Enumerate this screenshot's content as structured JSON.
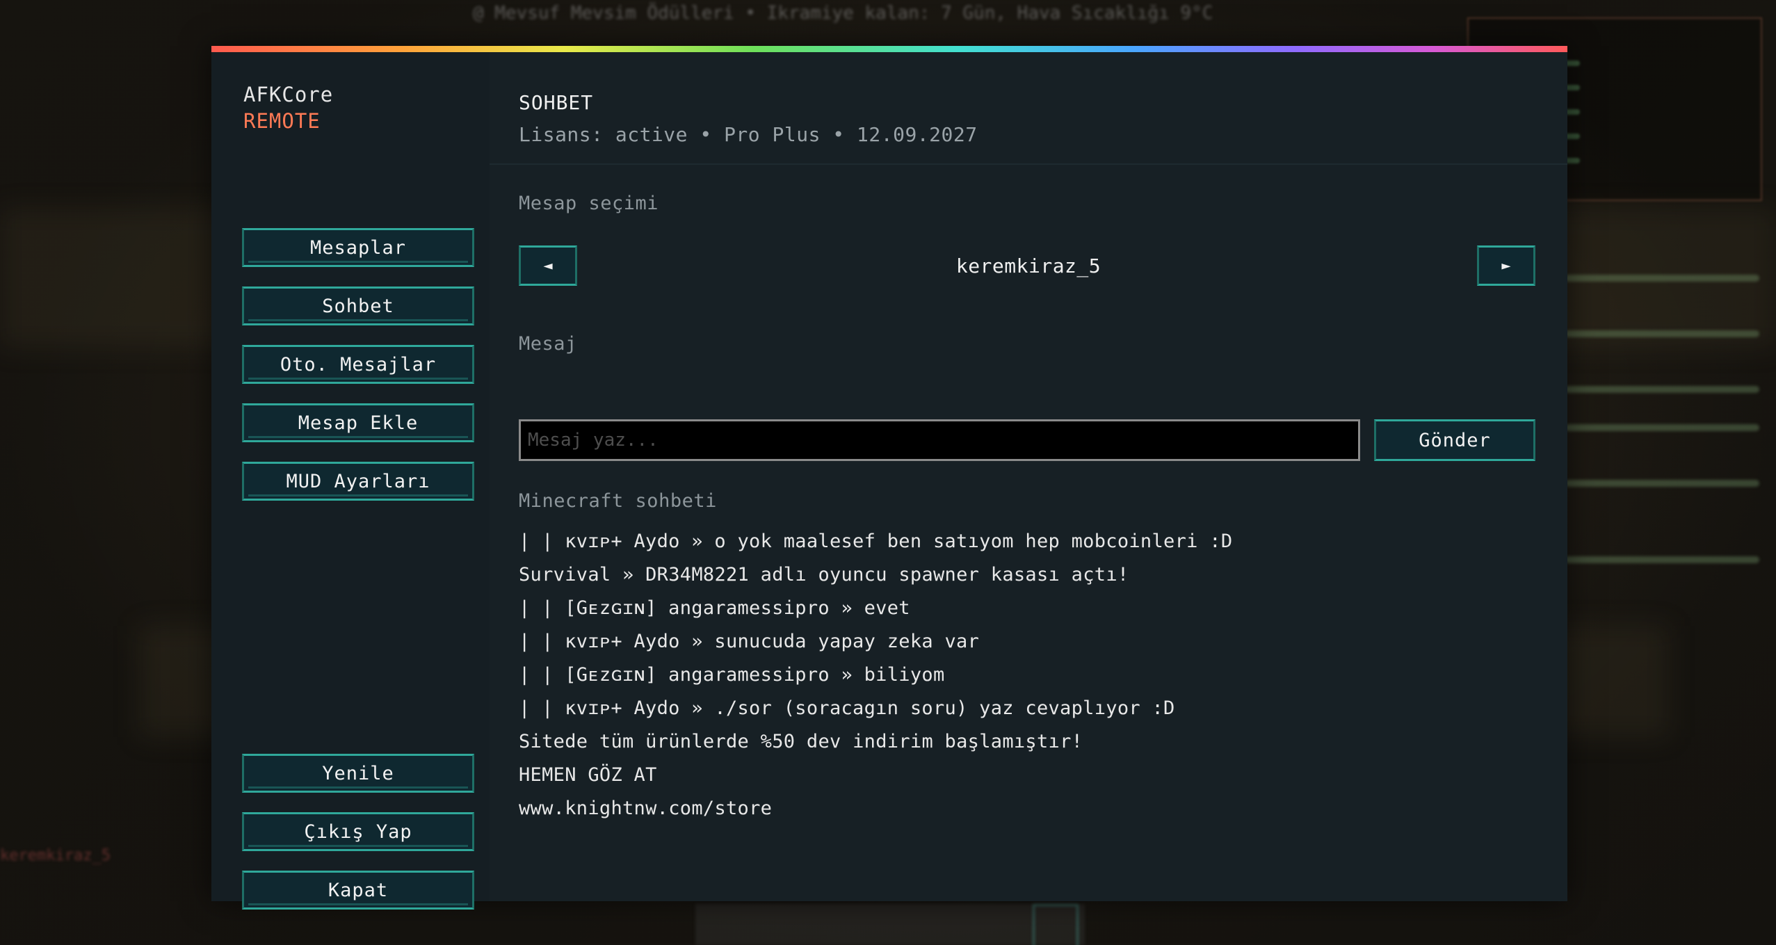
{
  "background": {
    "hud_top_text": "@ Mevsuf Mevsim Ödülleri • Ikramiye kalan: 7 Gün, Hava Sıcaklığı 9°C",
    "chat_left_text": "keremkiraz_5"
  },
  "sidebar": {
    "brand_title": "AFKCore",
    "brand_subtitle": "REMOTE",
    "nav_items": [
      {
        "label": "Mesaplar"
      },
      {
        "label": "Sohbet"
      },
      {
        "label": "Oto. Mesajlar"
      },
      {
        "label": "Mesap Ekle"
      },
      {
        "label": "MUD Ayarları"
      }
    ],
    "bottom_items": [
      {
        "label": "Yenile"
      },
      {
        "label": "Çıkış Yap"
      },
      {
        "label": "Kapat"
      }
    ]
  },
  "header": {
    "title": "SOHBET",
    "license_line": "Lisans: active • Pro Plus • 12.09.2027"
  },
  "account_selector": {
    "label": "Mesap seçimi",
    "prev_icon": "◄",
    "next_icon": "►",
    "current_account": "keremkiraz_5"
  },
  "message": {
    "label": "Mesaj",
    "input_value": "",
    "input_placeholder": "Mesaj yaz...",
    "send_label": "Gönder"
  },
  "chat": {
    "label": "Minecraft sohbeti",
    "lines": [
      "| | ĸvɪᴘ+ Aydo » o yok maalesef ben satıyom hep mobcoinleri :D",
      "Survival » DR34M8221 adlı oyuncu spawner kasası açtı!",
      "| | [Gᴇzɢɪɴ] angaramessipro » evet",
      "| | ĸvɪᴘ+ Aydo » sunucuda yapay zeka var",
      "| | [Gᴇzɢɪɴ] angaramessipro » biliyom",
      "| | ĸvɪᴘ+ Aydo » ./sor (soracagın soru) yaz cevaplıyor :D",
      "Sitede tüm ürünlerde %50 dev indirim başlamıştır!",
      "HEMEN GÖZ AT",
      "www.knightnw.com/store"
    ]
  },
  "colors": {
    "accent_teal": "#2fa89a",
    "brand_sub": "#ff7a55",
    "panel_bg": "#131b20"
  }
}
